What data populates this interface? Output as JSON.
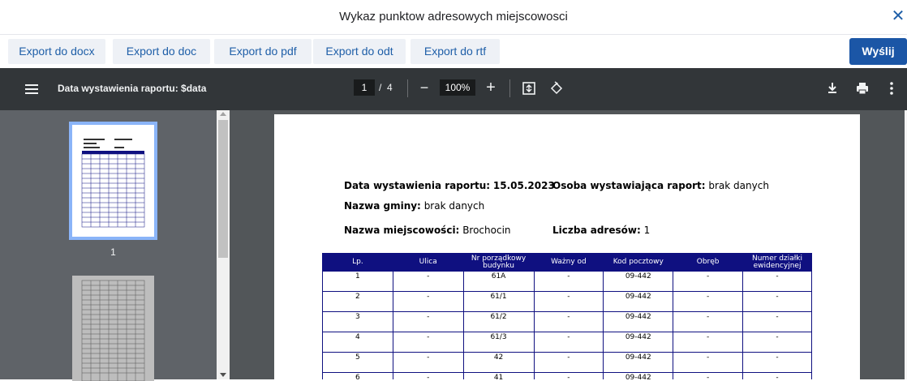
{
  "dialog": {
    "title": "Wykaz punktow adresowych miejscowosci",
    "close_icon": "close-icon"
  },
  "toolbar": {
    "exports": [
      "Export do docx",
      "Export do doc",
      "Export do pdf",
      "Export do odt",
      "Export do rtf"
    ],
    "send_label": "Wyślij"
  },
  "viewer": {
    "title": "Data wystawienia raportu: $data",
    "current_page": "1",
    "page_sep": "/",
    "total_pages": "4",
    "zoom": "100%",
    "sidebar_page_label": "1",
    "icons": [
      "menu-icon",
      "zoom-out-icon",
      "zoom-in-icon",
      "fit-page-icon",
      "rotate-icon",
      "download-icon",
      "print-icon",
      "more-icon"
    ]
  },
  "report": {
    "date_label": "Data wystawienia raportu:",
    "date_value": "15.05.2023",
    "issuer_label": "Osoba wystawiająca raport:",
    "issuer_value": "brak danych",
    "gmina_label": "Nazwa gminy:",
    "gmina_value": "brak danych",
    "miejscowosc_label": "Nazwa miejscowości:",
    "miejscowosc_value": "Brochocin",
    "count_label": "Liczba adresów:",
    "count_value": "1",
    "columns": [
      "Lp.",
      "Ulica",
      "Nr porządkowy budynku",
      "Ważny od",
      "Kod pocztowy",
      "Obręb",
      "Numer działki ewidencyjnej"
    ],
    "rows": [
      [
        "1",
        "-",
        "61A",
        "-",
        "09-442",
        "-",
        "-"
      ],
      [
        "2",
        "-",
        "61/1",
        "-",
        "09-442",
        "-",
        "-"
      ],
      [
        "3",
        "-",
        "61/2",
        "-",
        "09-442",
        "-",
        "-"
      ],
      [
        "4",
        "-",
        "61/3",
        "-",
        "09-442",
        "-",
        "-"
      ],
      [
        "5",
        "-",
        "42",
        "-",
        "09-442",
        "-",
        "-"
      ],
      [
        "6",
        "-",
        "41",
        "-",
        "09-442",
        "-",
        "-"
      ]
    ]
  },
  "colors": {
    "accent": "#1b56a6",
    "table_header": "#0f1080",
    "viewer_bar": "#323639"
  }
}
